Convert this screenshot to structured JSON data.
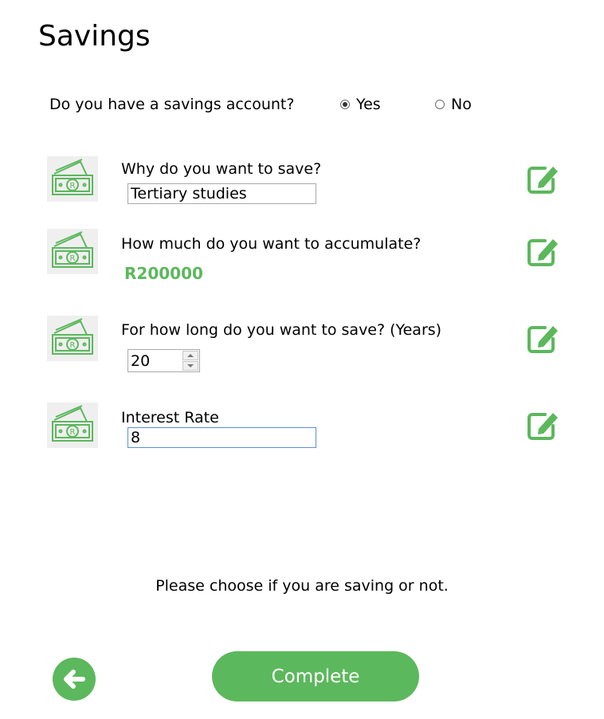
{
  "page": {
    "title": "Savings"
  },
  "savings_account": {
    "question": "Do you have a savings account?",
    "options": [
      "Yes",
      "No"
    ],
    "selected": "Yes"
  },
  "items": [
    {
      "label": "Why do you want to save?",
      "value": "Tertiary studies",
      "icon": "money-icon",
      "edit_icon": "edit-icon"
    },
    {
      "label": "How much do you want to accumulate?",
      "value": "R200000",
      "icon": "money-icon",
      "edit_icon": "edit-icon"
    },
    {
      "label": "For how long do you want to save? (Years)",
      "value": "20",
      "icon": "money-icon",
      "edit_icon": "edit-icon"
    },
    {
      "label": "Interest Rate",
      "value": "8",
      "icon": "money-icon",
      "edit_icon": "edit-icon"
    }
  ],
  "hint": "Please choose if you are saving or not.",
  "footer": {
    "back_icon": "arrow-left-icon",
    "complete_label": "Complete"
  },
  "colors": {
    "accent": "#5cb85c",
    "icon_bg": "#efefef"
  }
}
